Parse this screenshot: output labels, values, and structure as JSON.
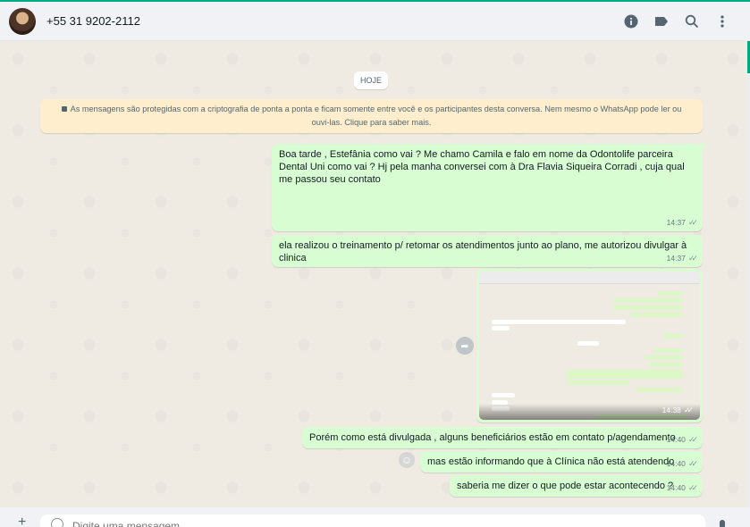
{
  "header": {
    "contact": "+55 31 9202-2112",
    "icons": [
      "info-icon",
      "label-icon",
      "search-icon",
      "menu-icon"
    ]
  },
  "chat": {
    "date_label": "HOJE",
    "encryption_notice": "As mensagens são protegidas com a criptografia de ponta a ponta e ficam somente entre você e os participantes desta conversa. Nem mesmo o WhatsApp pode ler ou ouvi-las. Clique para saber mais.",
    "messages": [
      {
        "text": "Boa tarde , Estefânia como vai ? Me chamo Camila e falo em nome da Odontolife parceira Dental Uni como vai ? Hj pela manha conversei com à Dra Flavia Siqueira Corradi , cuja qual me passou seu contato",
        "time": "14:37"
      },
      {
        "text": "ela realizou o treinamento p/ retomar os atendimentos junto ao plano, me autorizou divulgar à clinica",
        "time": "14:37"
      },
      {
        "type": "image",
        "time": "14:38"
      },
      {
        "text": "Porém como está divulgada , alguns beneficiários estão em contato p/agendamento",
        "time": "14:40"
      },
      {
        "text": "mas estão informando que à Clínica não está atendendo",
        "time": "14:40"
      },
      {
        "text": "saberia me dizer o que pode estar acontecendo ?",
        "time": "14:40"
      }
    ],
    "ticks": "✓✓"
  },
  "composer": {
    "placeholder": "Digite uma mensagem"
  },
  "colors": {
    "accent": "#00a884",
    "outgoing_bubble": "#d9fdd3",
    "notice_bg": "#ffeecd",
    "chat_bg": "#efeae2"
  }
}
